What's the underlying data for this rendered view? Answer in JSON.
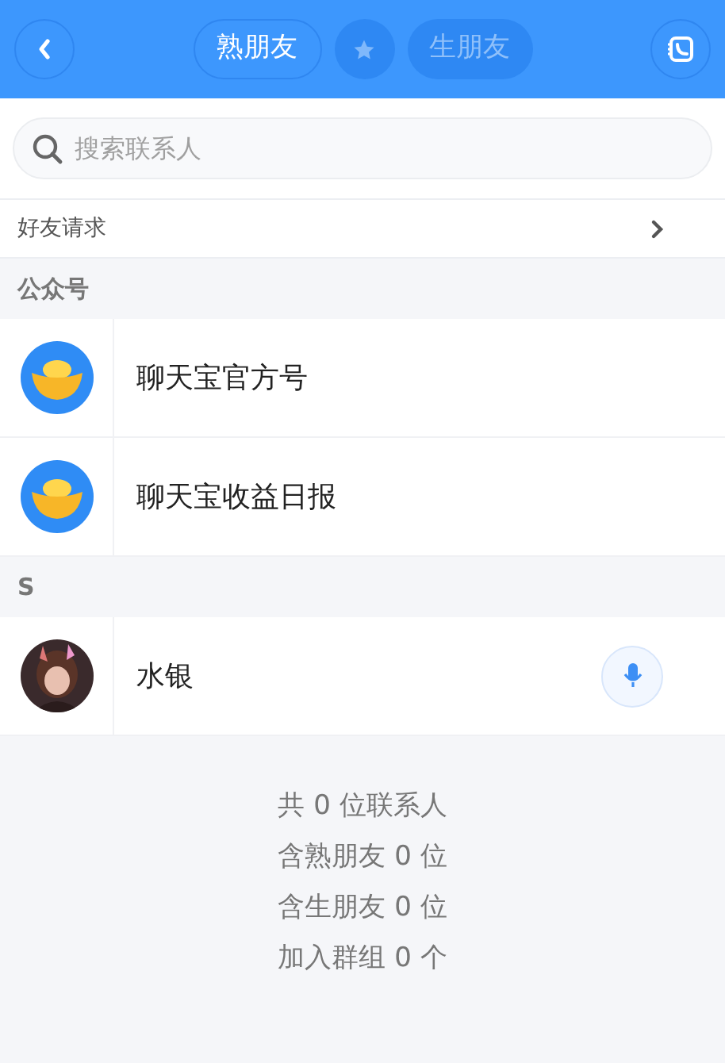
{
  "header": {
    "tabs": [
      {
        "label": "熟朋友",
        "selected": true
      },
      {
        "label": "生朋友",
        "selected": false
      }
    ]
  },
  "search": {
    "placeholder": "搜索联系人"
  },
  "friend_requests": {
    "label": "好友请求"
  },
  "sections": [
    {
      "title": "公众号",
      "contacts": [
        {
          "name": "聊天宝官方号",
          "kind": "ingot",
          "voice": false
        },
        {
          "name": "聊天宝收益日报",
          "kind": "ingot",
          "voice": false
        }
      ]
    },
    {
      "title": "S",
      "contacts": [
        {
          "name": "水银",
          "kind": "picture",
          "voice": true
        }
      ]
    }
  ],
  "summary": [
    "共 0 位联系人",
    "含熟朋友 0 位",
    "含生朋友 0 位",
    "加入群组 0 个"
  ]
}
